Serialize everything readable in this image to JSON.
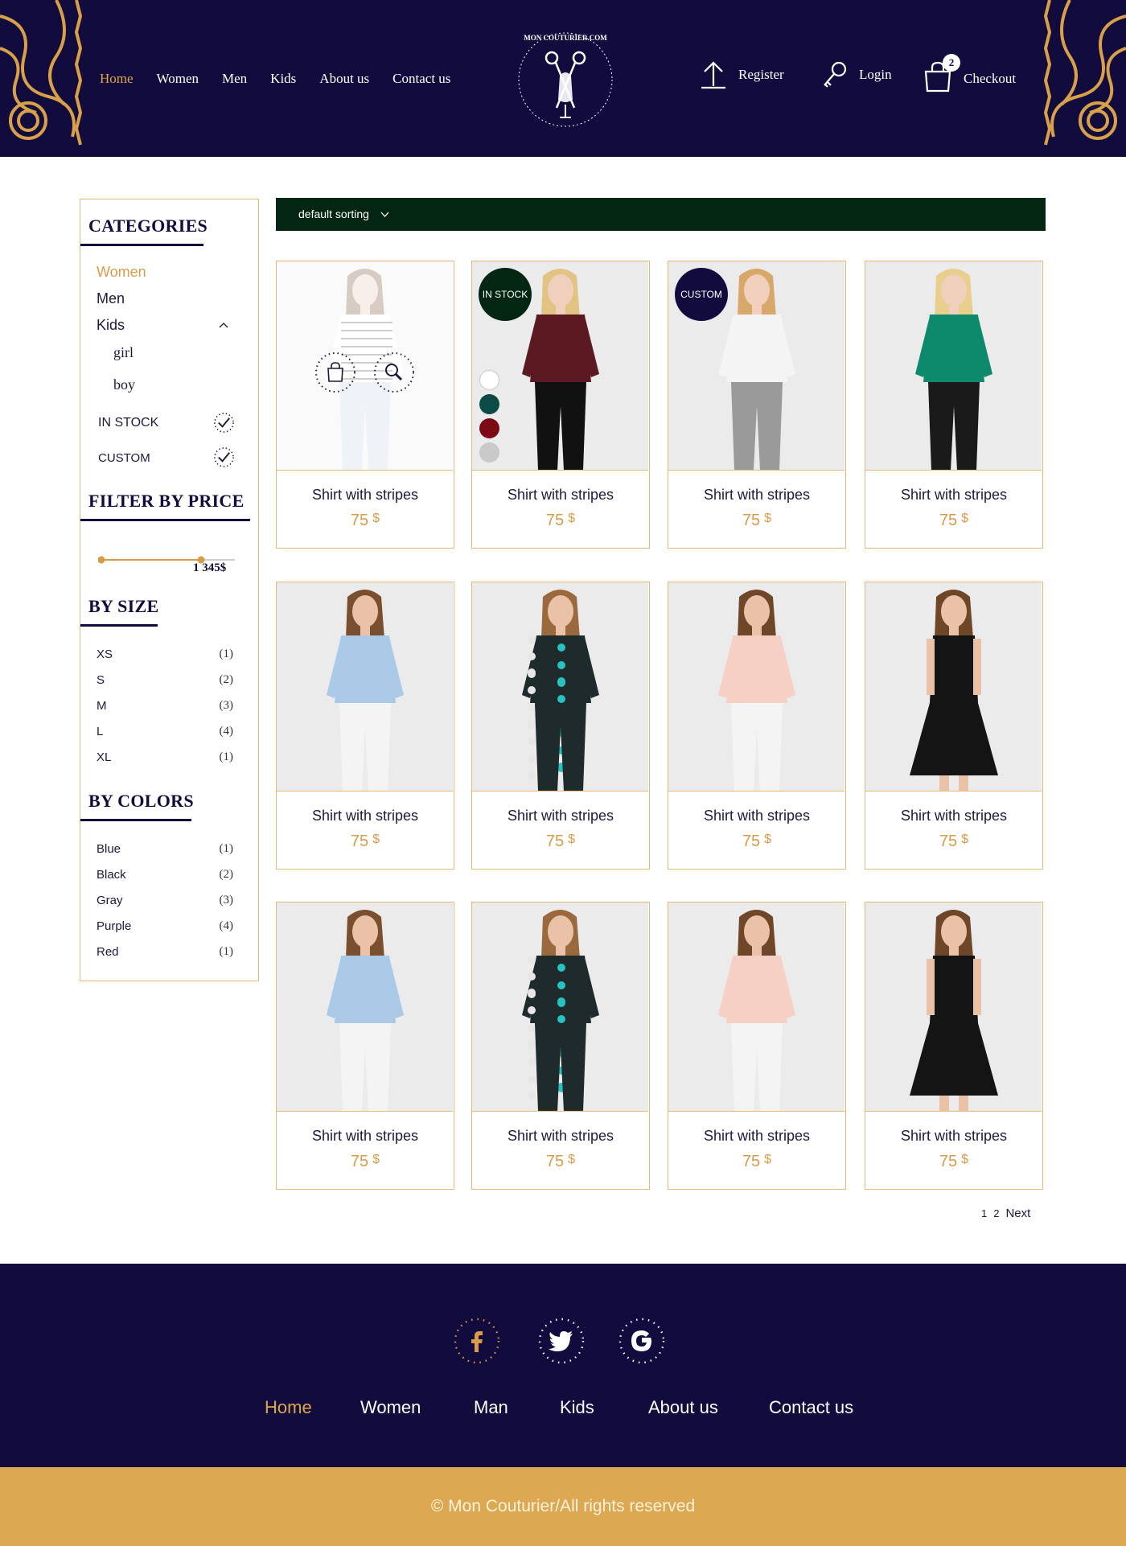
{
  "header": {
    "nav": [
      "Home",
      "Women",
      "Men",
      "Kids",
      "About us",
      "Contact us"
    ],
    "logo_text": "MON COUTURIER.COM",
    "register_label": "Register",
    "login_label": "Login",
    "checkout_label": "Checkout",
    "cart_count": "2"
  },
  "sidebar": {
    "categories_title": "CATEGORIES",
    "categories": [
      "Women",
      "Men",
      "Kids"
    ],
    "kids_sub": [
      "girl",
      "boy"
    ],
    "in_stock_label": "IN STOCK",
    "custom_label": "CUSTOM",
    "price_title": "FILTER BY PRICE",
    "price_max": "1 345$",
    "size_title": "BY SIZE",
    "sizes": [
      {
        "label": "XS",
        "count": "(1)"
      },
      {
        "label": "S",
        "count": "(2)"
      },
      {
        "label": "M",
        "count": "(3)"
      },
      {
        "label": "L",
        "count": "(4)"
      },
      {
        "label": "XL",
        "count": "(1)"
      }
    ],
    "colors_title": "BY COLORS",
    "colors": [
      {
        "label": "Blue",
        "count": "(1)"
      },
      {
        "label": "Black",
        "count": "(2)"
      },
      {
        "label": "Gray",
        "count": "(3)"
      },
      {
        "label": "Purple",
        "count": "(4)"
      },
      {
        "label": "Red",
        "count": "(1)"
      }
    ]
  },
  "sort": {
    "label": "default sorting"
  },
  "badges": {
    "in_stock": "IN STOCK",
    "custom": "CUSTOM"
  },
  "products": [
    {
      "name": "Shirt with stripes",
      "price": "75",
      "currency": "$"
    },
    {
      "name": "Shirt with stripes",
      "price": "75",
      "currency": "$"
    },
    {
      "name": "Shirt with stripes",
      "price": "75",
      "currency": "$"
    },
    {
      "name": "Shirt with stripes",
      "price": "75",
      "currency": "$"
    },
    {
      "name": "Shirt with stripes",
      "price": "75",
      "currency": "$"
    },
    {
      "name": "Shirt with stripes",
      "price": "75",
      "currency": "$"
    },
    {
      "name": "Shirt with stripes",
      "price": "75",
      "currency": "$"
    },
    {
      "name": "Shirt with stripes",
      "price": "75",
      "currency": "$"
    },
    {
      "name": "Shirt with stripes",
      "price": "75",
      "currency": "$"
    },
    {
      "name": "Shirt with stripes",
      "price": "75",
      "currency": "$"
    },
    {
      "name": "Shirt with stripes",
      "price": "75",
      "currency": "$"
    },
    {
      "name": "Shirt with stripes",
      "price": "75",
      "currency": "$"
    }
  ],
  "color_swatches": [
    "#ffffff",
    "#0b4a45",
    "#7c0a14",
    "#c9c9c9"
  ],
  "pagination": {
    "pages": [
      "1",
      "2"
    ],
    "next": "Next"
  },
  "footer": {
    "social": [
      "facebook-icon",
      "twitter-icon",
      "google-icon"
    ],
    "nav": [
      "Home",
      "Women",
      "Man",
      "Kids",
      "About us",
      "Contact us"
    ],
    "copyright": "© Mon Couturier/All rights reserved"
  },
  "colors": {
    "navy": "#120b3d",
    "gold": "#d79b4a",
    "green": "#032612",
    "border": "#e4b877"
  }
}
